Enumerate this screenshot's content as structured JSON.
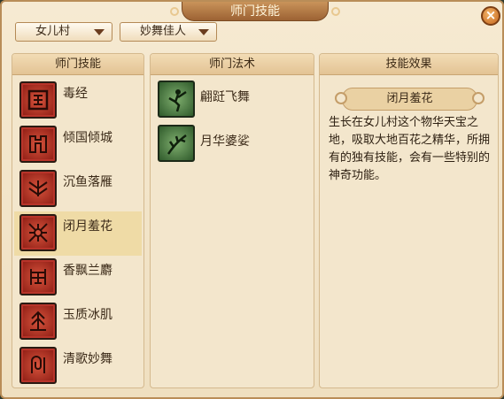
{
  "window": {
    "title": "师门技能",
    "close_glyph": "×"
  },
  "filters": {
    "sect": "女儿村",
    "role": "妙舞佳人"
  },
  "panels": {
    "skills_header": "师门技能",
    "spells_header": "师门法术",
    "effect_header": "技能效果"
  },
  "skills": [
    {
      "label": "毒经",
      "icon": "poison-scripture-icon"
    },
    {
      "label": "倾国倾城",
      "icon": "allure-icon"
    },
    {
      "label": "沉鱼落雁",
      "icon": "fish-goose-icon"
    },
    {
      "label": "闭月羞花",
      "icon": "moon-flower-icon",
      "selected": true
    },
    {
      "label": "香飘兰麝",
      "icon": "orchid-scent-icon"
    },
    {
      "label": "玉质冰肌",
      "icon": "jade-skin-icon"
    },
    {
      "label": "清歌妙舞",
      "icon": "song-dance-icon"
    }
  ],
  "spells": [
    {
      "label": "翩跹飞舞",
      "icon": "dancer-icon"
    },
    {
      "label": "月华婆娑",
      "icon": "branch-icon"
    }
  ],
  "effect": {
    "title": "闭月羞花",
    "description": "生长在女儿村这个物华天宝之地，吸取大地百花之精华，所拥有的独有技能，会有一些特别的神奇功能。"
  },
  "colors": {
    "accent": "#9c6233",
    "skill_icon_red": "#b8342a",
    "spell_icon_green": "#4f8a45",
    "selected_row": "#efdba6"
  }
}
